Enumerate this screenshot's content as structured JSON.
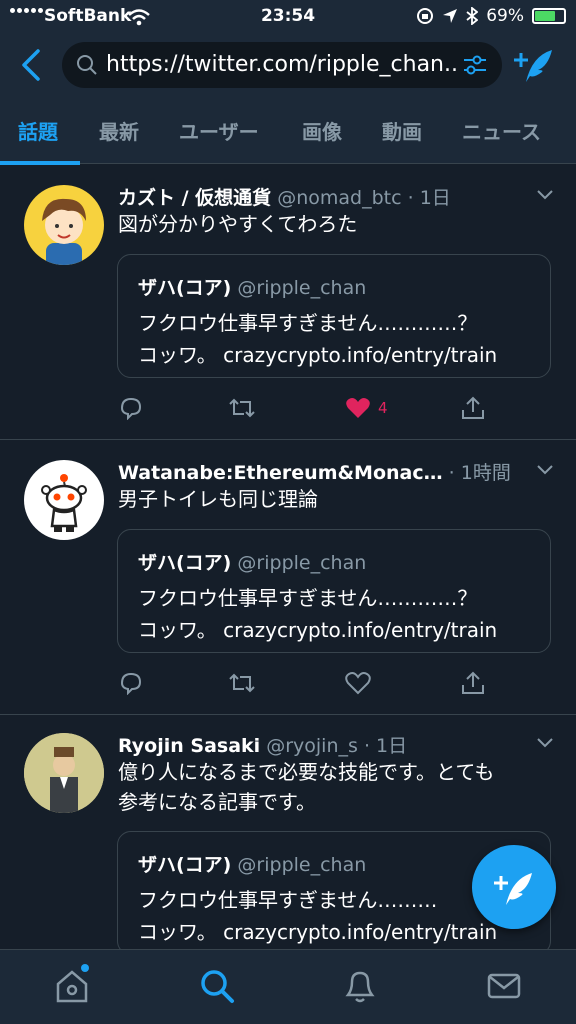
{
  "status": {
    "carrier": "SoftBank",
    "time": "23:54",
    "battery": "69%"
  },
  "search": {
    "url": "https://twitter.com/ripple_chan..."
  },
  "tabs": [
    "話題",
    "最新",
    "ユーザー",
    "画像",
    "動画",
    "ニュース"
  ],
  "tweets": [
    {
      "name": "カズト / 仮想通貨",
      "handle": "@nomad_btc",
      "time": "1日",
      "text": "図が分かりやすくてわろた",
      "quote": {
        "name": "ザハ(コア)",
        "handle": "@ripple_chan",
        "line1": "フクロウ仕事早すぎません…………？",
        "line2": "コッワ。 crazycrypto.info/entry/train"
      },
      "likes": "4"
    },
    {
      "name": "Watanabe:Ethereum&Monac…",
      "handle": "",
      "time": "1時間",
      "text": "男子トイレも同じ理論",
      "quote": {
        "name": "ザハ(コア)",
        "handle": "@ripple_chan",
        "line1": "フクロウ仕事早すぎません…………？",
        "line2": "コッワ。 crazycrypto.info/entry/train"
      },
      "likes": ""
    },
    {
      "name": "Ryojin Sasaki",
      "handle": "@ryojin_s",
      "time": "1日",
      "text1": "億り人になるまで必要な技能です。とても",
      "text2": "参考になる記事です。",
      "quote": {
        "name": "ザハ(コア)",
        "handle": "@ripple_chan",
        "line1": "フクロウ仕事早すぎません………",
        "line2": "コッワ。 crazycrypto.info/entry/train"
      },
      "likes": ""
    }
  ],
  "colors": {
    "accent": "#1da1f2",
    "like": "#e0245e",
    "background": "#151e29",
    "bar": "#1c2938"
  }
}
